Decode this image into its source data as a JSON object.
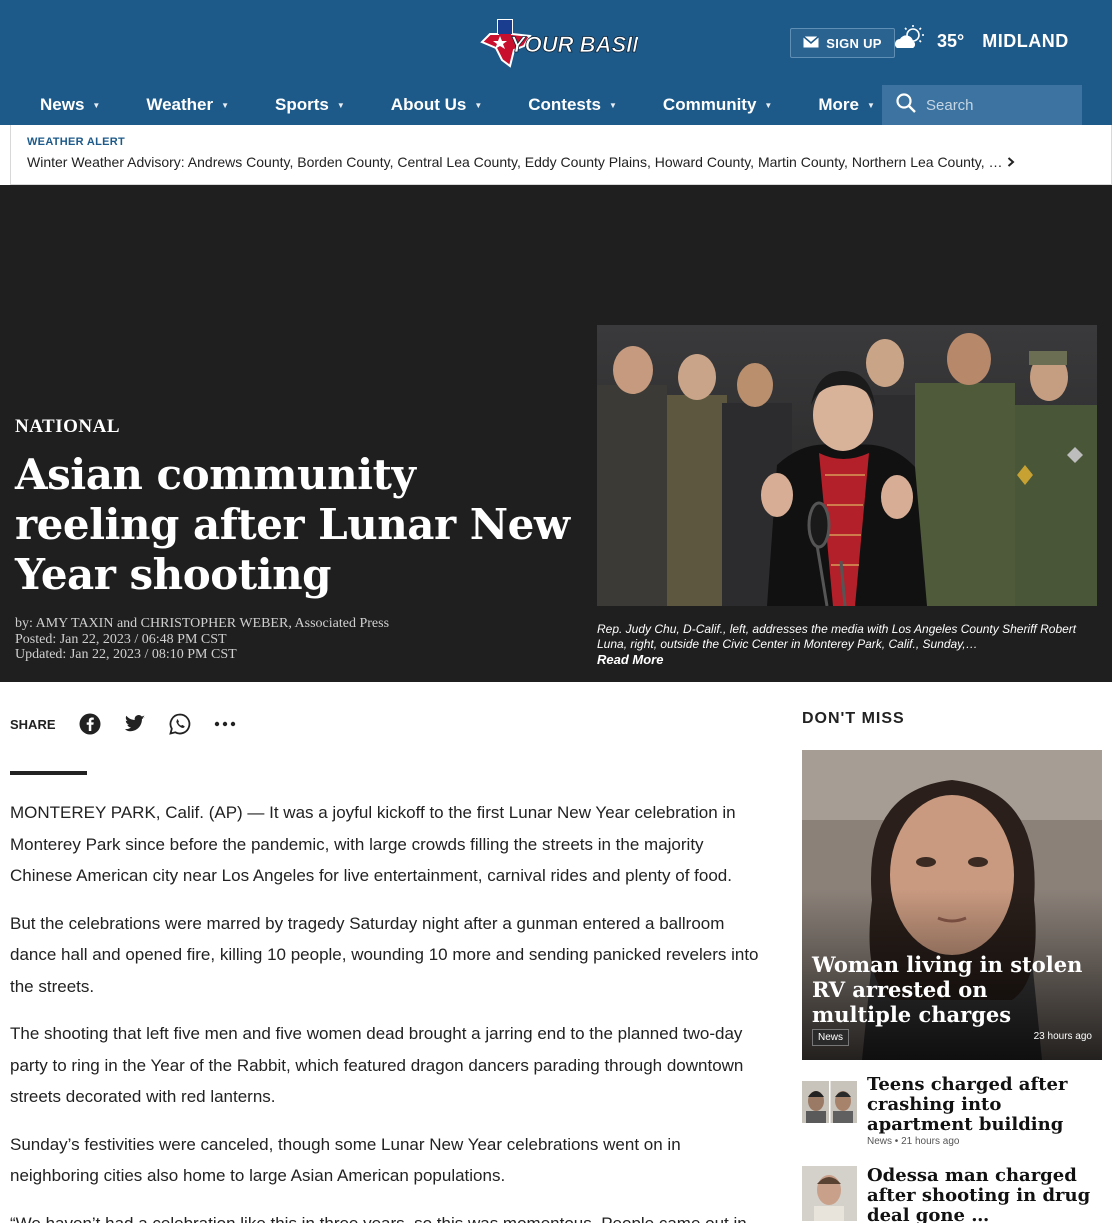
{
  "header": {
    "logo_text": "YOUR BASIN",
    "signup_label": "SIGN UP",
    "temperature": "35°",
    "city": "MIDLAND",
    "search_placeholder": "Search",
    "brand_color": "#1d5a8a"
  },
  "nav": {
    "items": [
      {
        "label": "News",
        "icon": "caret-down-icon"
      },
      {
        "label": "Weather",
        "icon": "caret-down-icon"
      },
      {
        "label": "Sports",
        "icon": "caret-down-icon"
      },
      {
        "label": "About Us",
        "icon": "caret-down-icon"
      },
      {
        "label": "Contests",
        "icon": "caret-down-icon"
      },
      {
        "label": "Community",
        "icon": "caret-down-icon"
      },
      {
        "label": "More",
        "icon": "caret-down-icon"
      }
    ]
  },
  "alert": {
    "title": "WEATHER ALERT",
    "text": "Winter Weather Advisory: Andrews County, Borden County, Central Lea County, Eddy County Plains, Howard County, Martin County, Northern Lea County, …"
  },
  "article": {
    "kicker": "NATIONAL",
    "headline": "Asian community reeling after Lunar New Year shooting",
    "byline": "by: AMY TAXIN and CHRISTOPHER WEBER, Associated Press",
    "posted": "Posted: Jan 22, 2023 / 06:48 PM CST",
    "updated": "Updated: Jan 22, 2023 / 08:10 PM CST",
    "caption": "Rep. Judy Chu, D-Calif., left, addresses the media with Los Angeles County Sheriff Robert Luna, right, outside the Civic Center in Monterey Park, Calif., Sunday,…",
    "read_more": "Read More",
    "share_label": "SHARE",
    "paragraphs": [
      "MONTEREY PARK, Calif. (AP) — It was a joyful kickoff to the first Lunar New Year celebration in Monterey Park since before the pandemic, with large crowds filling the streets in the majority Chinese American city near Los Angeles for live entertainment, carnival rides and plenty of food.",
      "But the celebrations were marred by tragedy Saturday night after a gunman entered a ballroom dance hall and opened fire, killing 10 people, wounding 10 more and sending panicked revelers into the streets.",
      "The shooting that left five men and five women dead brought a jarring end to the planned two-day party to ring in the Year of the Rabbit, which featured dragon dancers parading through downtown streets decorated with red lanterns.",
      "Sunday’s festivities were canceled, though some Lunar New Year celebrations went on in neighboring cities also home to large Asian American populations.",
      "“We haven’t had a celebration like this in three years, so this was momentous. People came out in"
    ]
  },
  "dont_miss": {
    "title": "DON'T MISS",
    "featured": {
      "title": "Woman living in stolen RV arrested on multiple charges",
      "tag": "News",
      "time": "23 hours ago"
    },
    "items": [
      {
        "title": "Teens charged after crashing into apartment building",
        "meta": "News • 21 hours ago"
      },
      {
        "title": "Odessa man charged after shooting in drug deal gone …",
        "meta": ""
      }
    ]
  }
}
